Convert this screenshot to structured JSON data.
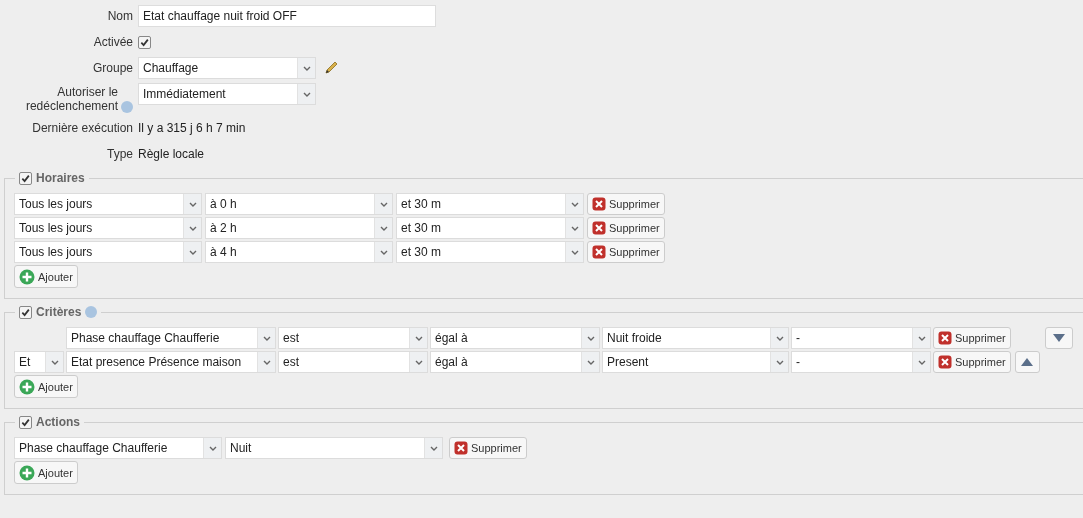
{
  "form": {
    "name_label": "Nom",
    "name_value": "Etat chauffage nuit froid OFF",
    "enabled_label": "Activée",
    "enabled": true,
    "group_label": "Groupe",
    "group_value": "Chauffage",
    "retrigger_label": "Autoriser le redéclenchement",
    "retrigger_value": "Immédiatement",
    "last_run_label": "Dernière exécution",
    "last_run_value": "Il y a 315 j 6 h 7 min",
    "type_label": "Type",
    "type_value": "Règle locale"
  },
  "schedules": {
    "title": "Horaires",
    "checked": true,
    "rows": [
      {
        "day": "Tous les jours",
        "hour": "à 0 h",
        "minute": "et 30 m",
        "delete": "Supprimer"
      },
      {
        "day": "Tous les jours",
        "hour": "à 2 h",
        "minute": "et 30 m",
        "delete": "Supprimer"
      },
      {
        "day": "Tous les jours",
        "hour": "à 4 h",
        "minute": "et 30 m",
        "delete": "Supprimer"
      }
    ],
    "add": "Ajouter"
  },
  "criteria": {
    "title": "Critères",
    "checked": true,
    "rows": [
      {
        "subject": "Phase chauffage Chaufferie",
        "operator": "est",
        "comparison": "égal à",
        "value": "Nuit froide",
        "extra": "-",
        "delete": "Supprimer",
        "move_button": {
          "kind": "down"
        }
      },
      {
        "conjunction": "Et",
        "subject": "Etat presence Présence maison",
        "operator": "est",
        "comparison": "égal à",
        "value": "Present",
        "extra": "-",
        "delete": "Supprimer",
        "move_button": {
          "kind": "up"
        }
      }
    ],
    "add": "Ajouter"
  },
  "actions": {
    "title": "Actions",
    "checked": true,
    "rows": [
      {
        "device": "Phase chauffage Chaufferie",
        "value": "Nuit",
        "delete": "Supprimer"
      }
    ],
    "add": "Ajouter"
  }
}
